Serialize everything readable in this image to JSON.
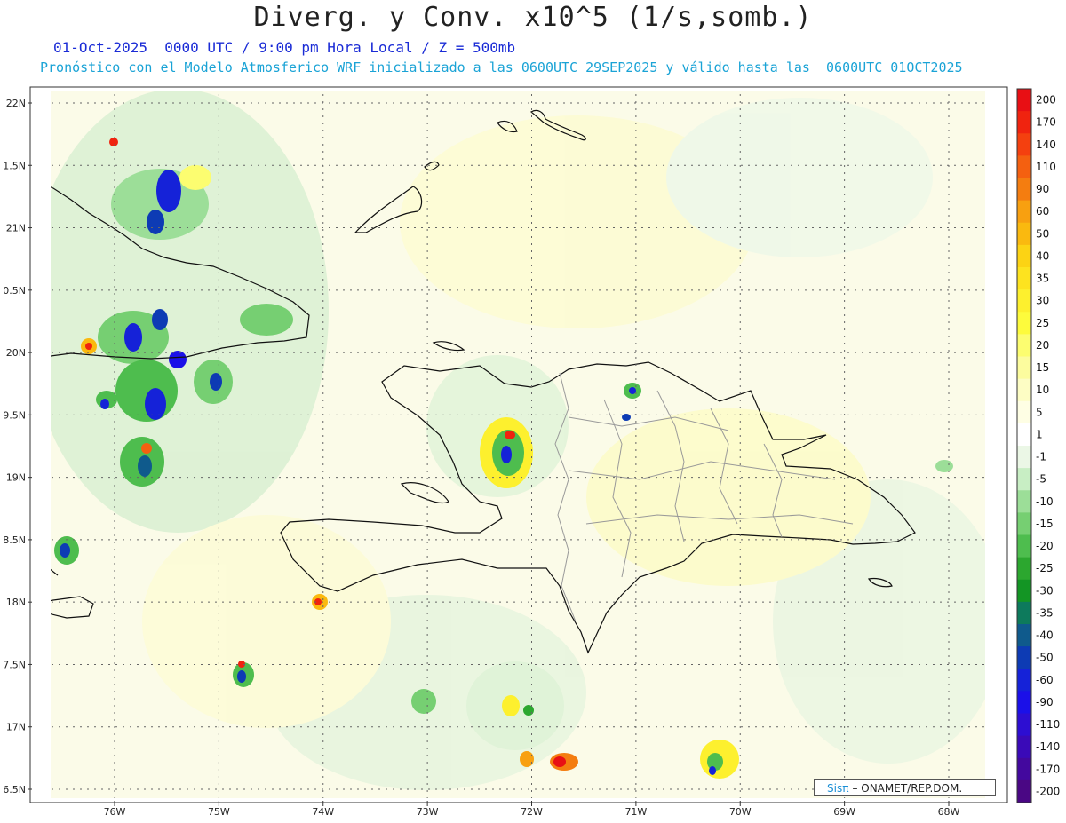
{
  "title": "Diverg. y Conv. x10^5 (1/s,somb.)",
  "subtitle_line1": "01-Oct-2025  0000 UTC / 9:00 pm Hora Local / Z = 500mb",
  "subtitle_line2": "Pronóstico con el Modelo Atmosferico WRF inicializado a las 0600UTC_29SEP2025 y válido hasta las  0600UTC_01OCT2025",
  "credit": {
    "brand": "Sisπ",
    "text": "– ONAMET/REP.DOM."
  },
  "map": {
    "lat_labels": [
      "22N",
      "1.5N",
      "21N",
      "0.5N",
      "20N",
      "9.5N",
      "19N",
      "8.5N",
      "18N",
      "7.5N",
      "17N",
      "6.5N"
    ],
    "lon_labels": [
      "76W",
      "75W",
      "74W",
      "73W",
      "72W",
      "71W",
      "70W",
      "69W",
      "68W"
    ],
    "lat_values": [
      22,
      21.5,
      21,
      20.5,
      20,
      19.5,
      19,
      18.5,
      18,
      17.5,
      17,
      16.5
    ],
    "lon_values": [
      -76,
      -75,
      -74,
      -73,
      -72,
      -71,
      -70,
      -69,
      -68
    ]
  },
  "colorbar": {
    "labels": [
      "200",
      "170",
      "140",
      "110",
      "90",
      "60",
      "50",
      "40",
      "35",
      "30",
      "25",
      "20",
      "15",
      "10",
      "5",
      "1",
      "-1",
      "-5",
      "-10",
      "-15",
      "-20",
      "-25",
      "-30",
      "-35",
      "-40",
      "-50",
      "-60",
      "-90",
      "-110",
      "-140",
      "-170",
      "-200"
    ],
    "colors": [
      "#e80f14",
      "#f0230f",
      "#f4400f",
      "#f46010",
      "#f47d10",
      "#f8a010",
      "#fab90f",
      "#fcd314",
      "#fde31f",
      "#fdf02e",
      "#fdfb3c",
      "#fcfd70",
      "#fcfc9e",
      "#fdfdc4",
      "#fefee4",
      "#ffffff",
      "#ebf7e6",
      "#c8eec4",
      "#9cde98",
      "#76cf72",
      "#4ebd4e",
      "#2ca72f",
      "#139524",
      "#0d7a5c",
      "#0f5a8c",
      "#0d3bb4",
      "#1522d8",
      "#1b10e8",
      "#2d0ed2",
      "#3a0ab8",
      "#43089e",
      "#4a0784"
    ]
  }
}
